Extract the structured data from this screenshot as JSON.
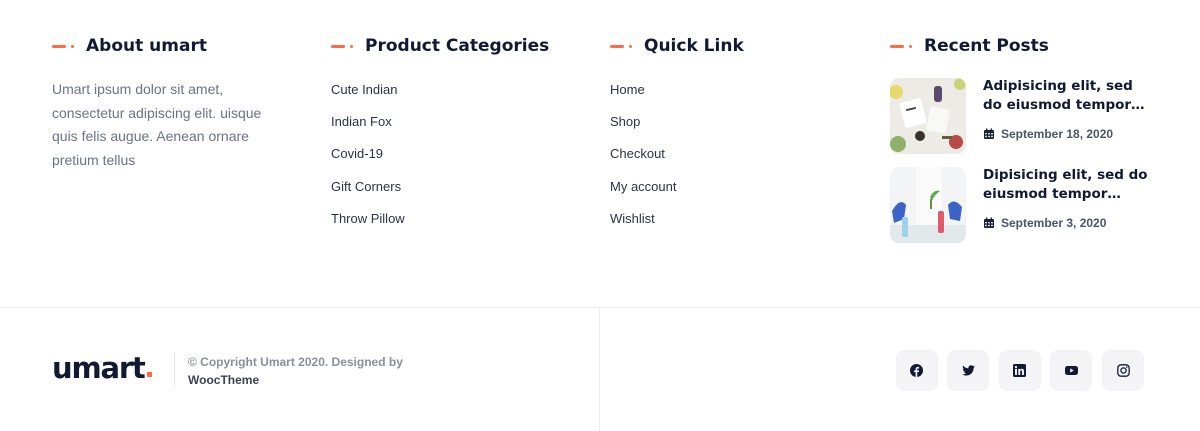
{
  "about": {
    "title": "About umart",
    "text": "Umart ipsum dolor sit amet, consectetur adipiscing elit. uisque quis felis augue. Aenean ornare pretium tellus"
  },
  "categories": {
    "title": "Product Categories",
    "items": [
      "Cute Indian",
      "Indian Fox",
      "Covid-19",
      "Gift Corners",
      "Throw Pillow"
    ]
  },
  "quick_links": {
    "title": "Quick Link",
    "items": [
      "Home",
      "Shop",
      "Checkout",
      "My account",
      "Wishlist"
    ]
  },
  "recent_posts": {
    "title": "Recent Posts",
    "posts": [
      {
        "title": "Adipisicing elit, sed do eiusmod tempor…",
        "date": "September 18, 2020"
      },
      {
        "title": "Dipisicing elit, sed do eiusmod tempor…",
        "date": "September 3, 2020"
      }
    ]
  },
  "bottom": {
    "brand": "umart",
    "copyright_line": "© Copyright Umart 2020. Designed by",
    "designer": "WoocTheme",
    "social": [
      "facebook-icon",
      "twitter-icon",
      "linkedin-icon",
      "youtube-icon",
      "instagram-icon"
    ]
  },
  "colors": {
    "accent": "#ff6a45",
    "heading": "#121a33",
    "social_bg": "#f4f4f7"
  }
}
